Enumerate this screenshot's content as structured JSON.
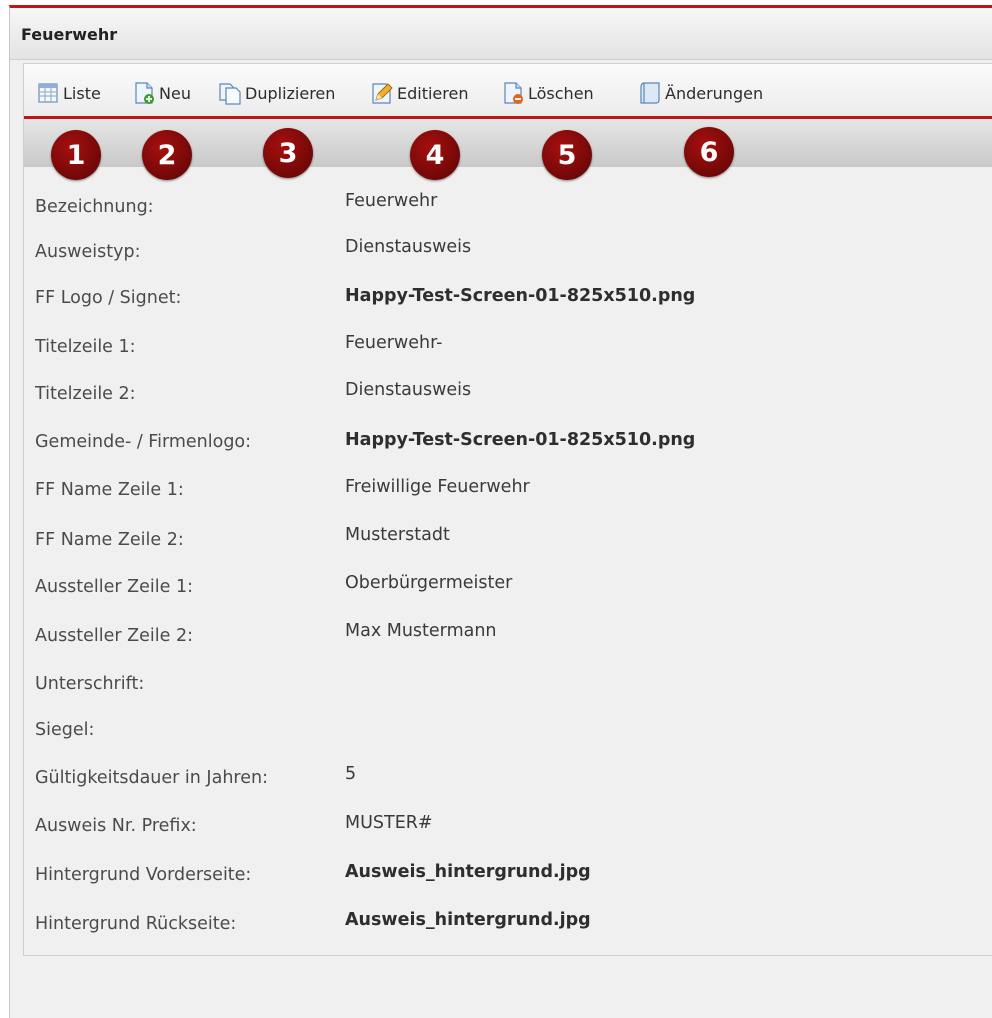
{
  "window": {
    "title": "Feuerwehr"
  },
  "toolbar": {
    "items": [
      {
        "label": "Liste",
        "icon": "table-list-icon"
      },
      {
        "label": "Neu",
        "icon": "new-document-icon"
      },
      {
        "label": "Duplizieren",
        "icon": "duplicate-icon"
      },
      {
        "label": "Editieren",
        "icon": "edit-pencil-icon"
      },
      {
        "label": "Löschen",
        "icon": "delete-document-icon"
      },
      {
        "label": "Änderungen",
        "icon": "changes-log-icon"
      }
    ]
  },
  "callouts": [
    "1",
    "2",
    "3",
    "4",
    "5",
    "6"
  ],
  "colors": {
    "accent_red": "#c0161a",
    "badge_red": "#8b0b0b"
  },
  "fields": [
    {
      "label": "Bezeichnung:",
      "value": "Feuerwehr",
      "bold": false
    },
    {
      "label": "Ausweistyp:",
      "value": "Dienstausweis",
      "bold": false
    },
    {
      "label": "FF Logo / Signet:",
      "value": "Happy-Test-Screen-01-825x510.png",
      "bold": true
    },
    {
      "label": "Titelzeile 1:",
      "value": "Feuerwehr-",
      "bold": false
    },
    {
      "label": "Titelzeile 2:",
      "value": "Dienstausweis",
      "bold": false
    },
    {
      "label": "Gemeinde- / Firmenlogo:",
      "value": "Happy-Test-Screen-01-825x510.png",
      "bold": true
    },
    {
      "label": "FF Name Zeile 1:",
      "value": "Freiwillige Feuerwehr",
      "bold": false
    },
    {
      "label": "FF Name Zeile 2:",
      "value": "Musterstadt",
      "bold": false
    },
    {
      "label": "Aussteller Zeile 1:",
      "value": "Oberbürgermeister",
      "bold": false
    },
    {
      "label": "Aussteller Zeile 2:",
      "value": "Max Mustermann",
      "bold": false
    },
    {
      "label": "Unterschrift:",
      "value": "",
      "bold": false
    },
    {
      "label": "Siegel:",
      "value": "",
      "bold": false
    },
    {
      "label": "Gültigkeitsdauer in Jahren:",
      "value": "5",
      "bold": false
    },
    {
      "label": "Ausweis Nr. Prefix:",
      "value": "MUSTER#",
      "bold": false
    },
    {
      "label": "Hintergrund Vorderseite:",
      "value": "Ausweis_hintergrund.jpg",
      "bold": true
    },
    {
      "label": "Hintergrund Rückseite:",
      "value": "Ausweis_hintergrund.jpg",
      "bold": true
    }
  ]
}
